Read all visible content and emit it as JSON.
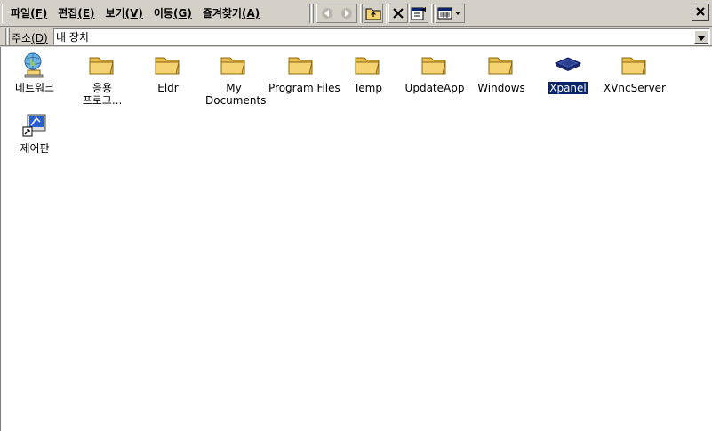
{
  "menubar": {
    "items": [
      {
        "label": "파일",
        "hotkey": "(F)"
      },
      {
        "label": "편집",
        "hotkey": "(E)"
      },
      {
        "label": "보기",
        "hotkey": "(V)"
      },
      {
        "label": "이동",
        "hotkey": "(G)"
      },
      {
        "label": "즐겨찾기",
        "hotkey": "(A)"
      }
    ]
  },
  "toolbar": {
    "buttons": [
      "back-icon",
      "forward-icon",
      "up-folder-icon",
      "delete-icon",
      "properties-icon",
      "views-icon"
    ]
  },
  "address": {
    "label": "주소",
    "hotkey": "(D)",
    "value": "내 장치"
  },
  "items": [
    {
      "label": "네트워크",
      "icon": "network-icon"
    },
    {
      "label": "응용 프로그...",
      "icon": "folder-icon"
    },
    {
      "label": "Eldr",
      "icon": "folder-icon"
    },
    {
      "label": "My Documents",
      "icon": "folder-icon"
    },
    {
      "label": "Program Files",
      "icon": "folder-icon"
    },
    {
      "label": "Temp",
      "icon": "folder-icon"
    },
    {
      "label": "UpdateApp",
      "icon": "folder-icon"
    },
    {
      "label": "Windows",
      "icon": "folder-icon"
    },
    {
      "label": "Xpanel",
      "icon": "drive-icon",
      "selected": true
    },
    {
      "label": "XVncServer",
      "icon": "folder-icon"
    },
    {
      "label": "제어판",
      "icon": "control-panel-icon"
    }
  ],
  "colors": {
    "face": "#d4d0c8",
    "selection": "#0a246a",
    "folder": "#f5d372"
  }
}
